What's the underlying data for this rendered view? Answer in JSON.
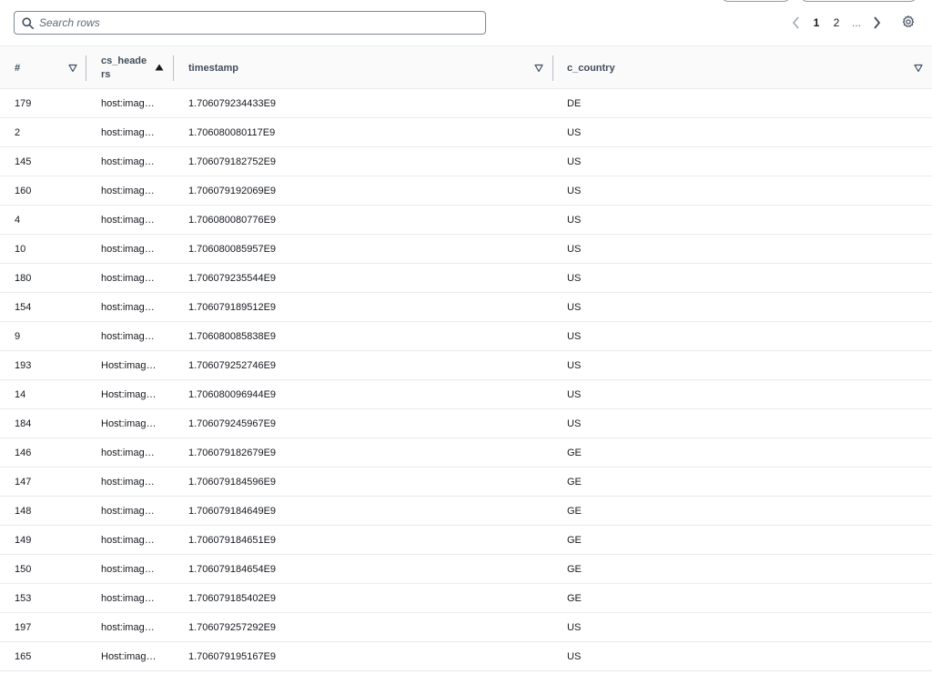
{
  "search": {
    "placeholder": "Search rows",
    "value": ""
  },
  "pagination": {
    "pages": [
      "1",
      "2"
    ],
    "current": "1",
    "ellipsis": "..."
  },
  "icons": {
    "search": "search-icon",
    "prev": "chevron-left-icon",
    "next": "chevron-right-icon",
    "settings": "gear-icon",
    "filter": "filter-icon",
    "sort": "sort-ascending-icon"
  },
  "columns": [
    {
      "key": "num",
      "label": "#"
    },
    {
      "key": "cs_headers",
      "label_line1": "cs_heade",
      "label_line2": "rs",
      "sorted": "ascending"
    },
    {
      "key": "timestamp",
      "label": "timestamp"
    },
    {
      "key": "c_country",
      "label": "c_country"
    }
  ],
  "rows": [
    {
      "num": "179",
      "cs_headers": "host:imag…",
      "timestamp": "1.706079234433E9",
      "c_country": "DE"
    },
    {
      "num": "2",
      "cs_headers": "host:imag…",
      "timestamp": "1.706080080117E9",
      "c_country": "US"
    },
    {
      "num": "145",
      "cs_headers": "host:imag…",
      "timestamp": "1.706079182752E9",
      "c_country": "US"
    },
    {
      "num": "160",
      "cs_headers": "host:imag…",
      "timestamp": "1.706079192069E9",
      "c_country": "US"
    },
    {
      "num": "4",
      "cs_headers": "host:imag…",
      "timestamp": "1.706080080776E9",
      "c_country": "US"
    },
    {
      "num": "10",
      "cs_headers": "host:imag…",
      "timestamp": "1.706080085957E9",
      "c_country": "US"
    },
    {
      "num": "180",
      "cs_headers": "host:imag…",
      "timestamp": "1.706079235544E9",
      "c_country": "US"
    },
    {
      "num": "154",
      "cs_headers": "host:imag…",
      "timestamp": "1.706079189512E9",
      "c_country": "US"
    },
    {
      "num": "9",
      "cs_headers": "host:imag…",
      "timestamp": "1.706080085838E9",
      "c_country": "US"
    },
    {
      "num": "193",
      "cs_headers": "Host:imag…",
      "timestamp": "1.706079252746E9",
      "c_country": "US"
    },
    {
      "num": "14",
      "cs_headers": "Host:imag…",
      "timestamp": "1.706080096944E9",
      "c_country": "US"
    },
    {
      "num": "184",
      "cs_headers": "Host:imag…",
      "timestamp": "1.706079245967E9",
      "c_country": "US"
    },
    {
      "num": "146",
      "cs_headers": "host:imag…",
      "timestamp": "1.706079182679E9",
      "c_country": "GE"
    },
    {
      "num": "147",
      "cs_headers": "host:imag…",
      "timestamp": "1.706079184596E9",
      "c_country": "GE"
    },
    {
      "num": "148",
      "cs_headers": "host:imag…",
      "timestamp": "1.706079184649E9",
      "c_country": "GE"
    },
    {
      "num": "149",
      "cs_headers": "host:imag…",
      "timestamp": "1.706079184651E9",
      "c_country": "GE"
    },
    {
      "num": "150",
      "cs_headers": "host:imag…",
      "timestamp": "1.706079184654E9",
      "c_country": "GE"
    },
    {
      "num": "153",
      "cs_headers": "host:imag…",
      "timestamp": "1.706079185402E9",
      "c_country": "GE"
    },
    {
      "num": "197",
      "cs_headers": "host:imag…",
      "timestamp": "1.706079257292E9",
      "c_country": "US"
    },
    {
      "num": "165",
      "cs_headers": "Host:imag…",
      "timestamp": "1.706079195167E9",
      "c_country": "US"
    }
  ]
}
